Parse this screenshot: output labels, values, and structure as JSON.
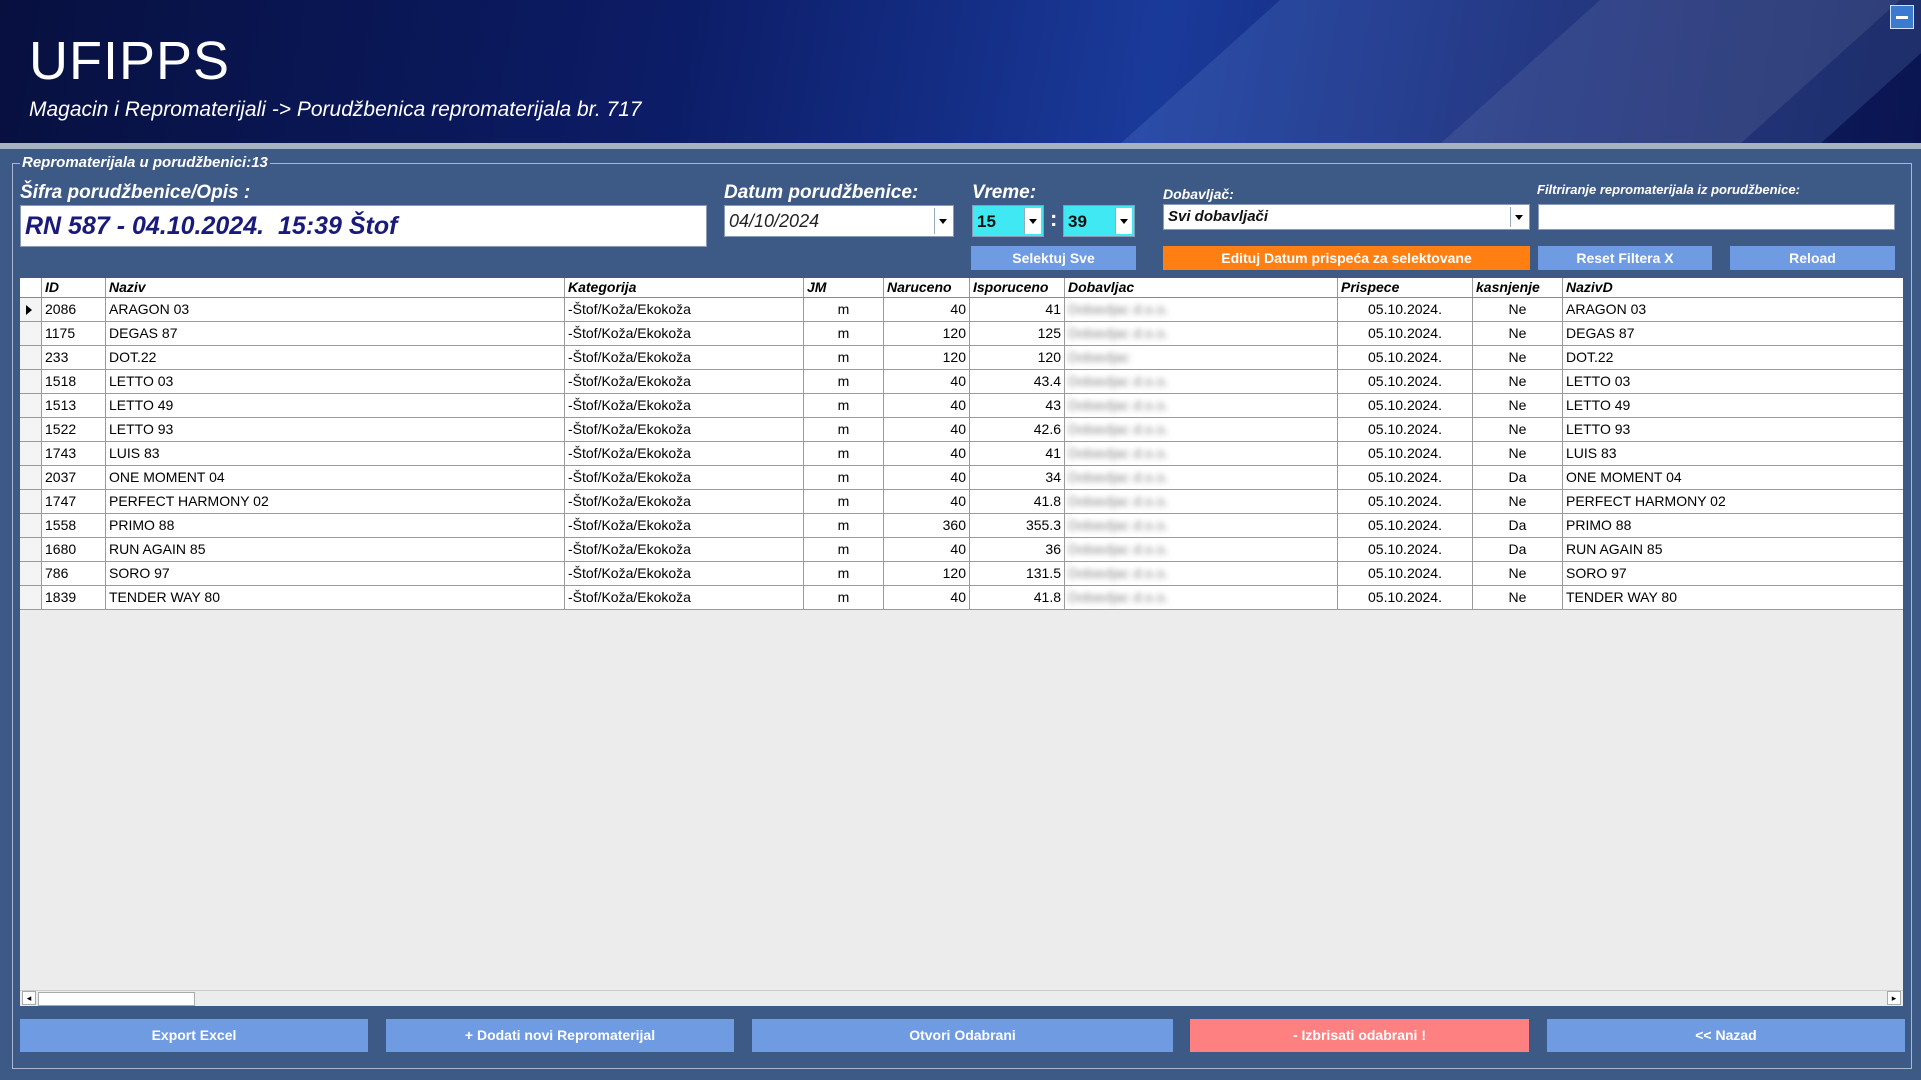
{
  "header": {
    "title": "UFIPPS",
    "breadcrumb": "Magacin i Repromaterijali -> Porudžbenica repromaterijala br. 717"
  },
  "group": {
    "legend": "Repromaterijala u porudžbenici:13"
  },
  "form": {
    "sifra_label": "Šifra porudžbenice/Opis :",
    "sifra_value": "RN 587 - 04.10.2024.  15:39 Štof",
    "datum_label": "Datum porudžbenice:",
    "datum_value": "04/10/2024",
    "vreme_label": "Vreme:",
    "hour": "15",
    "minute": "39",
    "time_sep": ":",
    "dobavljac_label": "Dobavljač:",
    "dobavljac_value": "Svi dobavljači",
    "filter_label": "Filtriranje repromaterijala iz porudžbenice:",
    "filter_value": ""
  },
  "buttons": {
    "selektuj": "Selektuj Sve",
    "edituj": "Edituj Datum prispeća za selektovane",
    "reset": "Reset Filtera X",
    "reload": "Reload",
    "export": "Export Excel",
    "dodati": "+ Dodati novi Repromaterijal",
    "otvori": "Otvori Odabrani",
    "izbrisati": "- Izbrisati odabrani !",
    "nazad": "<< Nazad"
  },
  "grid": {
    "columns": [
      "ID",
      "Naziv",
      "Kategorija",
      "JM",
      "Naruceno",
      "Isporuceno",
      "Dobavljac",
      "Prispece",
      "kasnjenje",
      "NazivD"
    ],
    "rows": [
      {
        "id": "2086",
        "naziv": "ARAGON 03",
        "kategorija": "-Štof/Koža/Ekokoža",
        "jm": "m",
        "naruceno": "40",
        "isporuceno": "41",
        "dobavljac": "Dobavljac d.o.o.",
        "prispece": "05.10.2024.",
        "kasnjenje": "Ne",
        "nazivd": "ARAGON 03"
      },
      {
        "id": "1175",
        "naziv": "DEGAS 87",
        "kategorija": "-Štof/Koža/Ekokoža",
        "jm": "m",
        "naruceno": "120",
        "isporuceno": "125",
        "dobavljac": "Dobavljac d.o.o.",
        "prispece": "05.10.2024.",
        "kasnjenje": "Ne",
        "nazivd": "DEGAS 87"
      },
      {
        "id": "233",
        "naziv": "DOT.22",
        "kategorija": "-Štof/Koža/Ekokoža",
        "jm": "m",
        "naruceno": "120",
        "isporuceno": "120",
        "dobavljac": "Dobavljac",
        "prispece": "05.10.2024.",
        "kasnjenje": "Ne",
        "nazivd": "DOT.22"
      },
      {
        "id": "1518",
        "naziv": "LETTO 03",
        "kategorija": "-Štof/Koža/Ekokoža",
        "jm": "m",
        "naruceno": "40",
        "isporuceno": "43.4",
        "dobavljac": "Dobavljac d.o.o.",
        "prispece": "05.10.2024.",
        "kasnjenje": "Ne",
        "nazivd": "LETTO 03"
      },
      {
        "id": "1513",
        "naziv": "LETTO 49",
        "kategorija": "-Štof/Koža/Ekokoža",
        "jm": "m",
        "naruceno": "40",
        "isporuceno": "43",
        "dobavljac": "Dobavljac d.o.o.",
        "prispece": "05.10.2024.",
        "kasnjenje": "Ne",
        "nazivd": "LETTO 49"
      },
      {
        "id": "1522",
        "naziv": "LETTO 93",
        "kategorija": "-Štof/Koža/Ekokoža",
        "jm": "m",
        "naruceno": "40",
        "isporuceno": "42.6",
        "dobavljac": "Dobavljac d.o.o.",
        "prispece": "05.10.2024.",
        "kasnjenje": "Ne",
        "nazivd": "LETTO 93"
      },
      {
        "id": "1743",
        "naziv": "LUIS 83",
        "kategorija": "-Štof/Koža/Ekokoža",
        "jm": "m",
        "naruceno": "40",
        "isporuceno": "41",
        "dobavljac": "Dobavljac d.o.o.",
        "prispece": "05.10.2024.",
        "kasnjenje": "Ne",
        "nazivd": "LUIS 83"
      },
      {
        "id": "2037",
        "naziv": "ONE MOMENT 04",
        "kategorija": "-Štof/Koža/Ekokoža",
        "jm": "m",
        "naruceno": "40",
        "isporuceno": "34",
        "dobavljac": "Dobavljac d.o.o.",
        "prispece": "05.10.2024.",
        "kasnjenje": "Da",
        "nazivd": "ONE MOMENT 04"
      },
      {
        "id": "1747",
        "naziv": "PERFECT HARMONY 02",
        "kategorija": "-Štof/Koža/Ekokoža",
        "jm": "m",
        "naruceno": "40",
        "isporuceno": "41.8",
        "dobavljac": "Dobavljac d.o.o.",
        "prispece": "05.10.2024.",
        "kasnjenje": "Ne",
        "nazivd": "PERFECT HARMONY 02"
      },
      {
        "id": "1558",
        "naziv": "PRIMO 88",
        "kategorija": "-Štof/Koža/Ekokoža",
        "jm": "m",
        "naruceno": "360",
        "isporuceno": "355.3",
        "dobavljac": "Dobavljac d.o.o.",
        "prispece": "05.10.2024.",
        "kasnjenje": "Da",
        "nazivd": "PRIMO 88"
      },
      {
        "id": "1680",
        "naziv": "RUN AGAIN 85",
        "kategorija": "-Štof/Koža/Ekokoža",
        "jm": "m",
        "naruceno": "40",
        "isporuceno": "36",
        "dobavljac": "Dobavljac d.o.o.",
        "prispece": "05.10.2024.",
        "kasnjenje": "Da",
        "nazivd": "RUN AGAIN 85"
      },
      {
        "id": "786",
        "naziv": "SORO 97",
        "kategorija": "-Štof/Koža/Ekokoža",
        "jm": "m",
        "naruceno": "120",
        "isporuceno": "131.5",
        "dobavljac": "Dobavljac d.o.o.",
        "prispece": "05.10.2024.",
        "kasnjenje": "Ne",
        "nazivd": "SORO 97"
      },
      {
        "id": "1839",
        "naziv": "TENDER WAY 80",
        "kategorija": "-Štof/Koža/Ekokoža",
        "jm": "m",
        "naruceno": "40",
        "isporuceno": "41.8",
        "dobavljac": "Dobavljac d.o.o.",
        "prispece": "05.10.2024.",
        "kasnjenje": "Ne",
        "nazivd": "TENDER WAY 80"
      }
    ]
  },
  "colors": {
    "header_dark": "#07103f",
    "body_bg": "#3d5a86",
    "button_blue": "#6e9be2",
    "button_orange": "#ff7f12",
    "button_red": "#ff8080"
  }
}
